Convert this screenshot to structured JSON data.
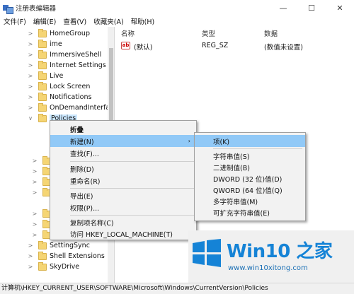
{
  "window": {
    "title": "注册表编辑器",
    "minimize": "—",
    "maximize": "☐",
    "close": "✕"
  },
  "menu": [
    "文件(F)",
    "编辑(E)",
    "查看(V)",
    "收藏夹(A)",
    "帮助(H)"
  ],
  "tree": {
    "items": [
      {
        "label": "HomeGroup",
        "chevron": ">"
      },
      {
        "label": "ime",
        "chevron": ">"
      },
      {
        "label": "ImmersiveShell",
        "chevron": ">"
      },
      {
        "label": "Internet Settings",
        "chevron": ">"
      },
      {
        "label": "Live",
        "chevron": ">"
      },
      {
        "label": "Lock Screen",
        "chevron": ">"
      },
      {
        "label": "Notifications",
        "chevron": ">"
      },
      {
        "label": "OnDemandInterfac",
        "chevron": ">"
      },
      {
        "label": "Policies",
        "chevron": "∨"
      },
      {
        "label": "P",
        "chevron": ">"
      },
      {
        "label": "P",
        "chevron": ">"
      },
      {
        "label": "R",
        "chevron": ">"
      },
      {
        "label": "R",
        "chevron": ">"
      },
      {
        "label": "S",
        "chevron": ">"
      },
      {
        "label": "S",
        "chevron": ">"
      },
      {
        "label": "S",
        "chevron": ">"
      },
      {
        "label": "SettingSync",
        "chevron": ">"
      },
      {
        "label": "Shell Extensions",
        "chevron": ">"
      },
      {
        "label": "SkyDrive",
        "chevron": ">"
      }
    ]
  },
  "list": {
    "headers": {
      "name": "名称",
      "type": "类型",
      "data": "数据"
    },
    "rows": [
      {
        "icon_text": "ab",
        "name": "(默认)",
        "type": "REG_SZ",
        "data": "(数值未设置)"
      }
    ]
  },
  "context_menu": {
    "items": [
      "折叠",
      "新建(N)",
      "查找(F)...",
      "删除(D)",
      "重命名(R)",
      "导出(E)",
      "权限(P)...",
      "复制项名称(C)",
      "访问 HKEY_LOCAL_MACHINE(T)"
    ],
    "submenu_arrow": "›"
  },
  "submenu": {
    "items": [
      "项(K)",
      "字符串值(S)",
      "二进制值(B)",
      "DWORD (32 位)值(D)",
      "QWORD (64 位)值(Q)",
      "多字符串值(M)",
      "可扩充字符串值(E)"
    ]
  },
  "status_bar": {
    "path": "计算机\\HKEY_CURRENT_USER\\SOFTWARE\\Microsoft\\Windows\\CurrentVersion\\Policies"
  },
  "watermark": {
    "title": "Win10 之家",
    "url": "www.win10xitong.com",
    "colors": {
      "brand": "#1583d6"
    }
  },
  "colors": {
    "highlight": "#91c9f7",
    "tree_selection": "#cce8ff",
    "folder": "#f5d574"
  }
}
